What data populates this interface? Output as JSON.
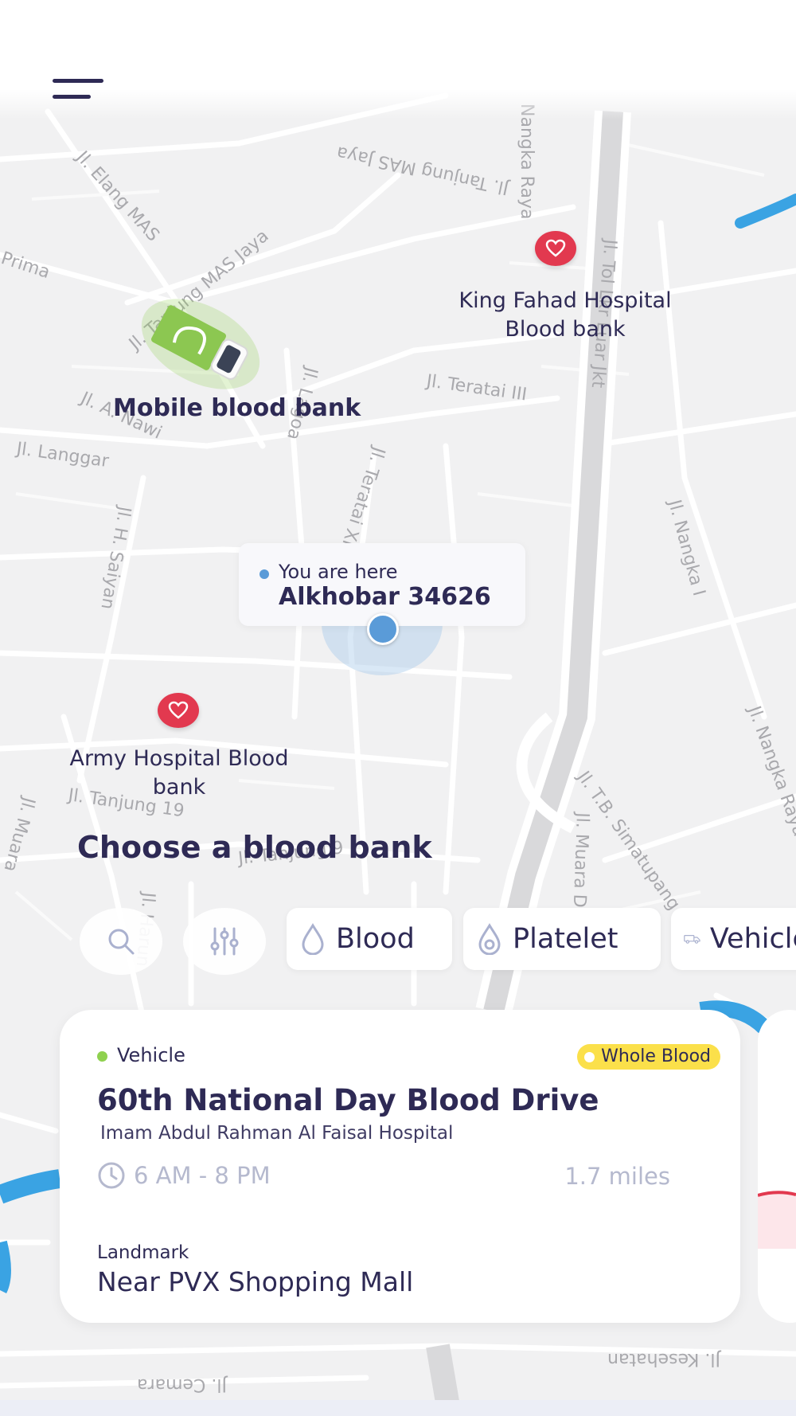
{
  "map": {
    "mobile_unit_label": "Mobile blood bank",
    "hospitals": [
      {
        "name": "King Fahad Hospital Blood bank"
      },
      {
        "name": "Army Hospital Blood bank"
      }
    ],
    "streets": [
      "Jl. Tanjung MAS Jaya",
      "Jl. Elang MAS",
      "Jl. Tanjung MAS Jaya",
      "Prima",
      "Jl. Teratai III",
      "Jl. Langgar",
      "Jl. H. Saiyan",
      "Jl. Teratai XI",
      "Jl. Nangka I",
      "Jl. T.B. Simatupang",
      "Jl. Tanjung 19",
      "Jl. Tanjung 9",
      "Jl. Kesehatan",
      "Jl. Cemara",
      "Jl. Muara Da",
      "Jl. Harun",
      "Jl. Tol Lkr Luar Jkt",
      "Jl. Nangka Raya",
      "Jl. A. Nawi",
      "Jl. Lagoa",
      "Nangka Raya",
      "Jl. Muara"
    ],
    "you_are_here": {
      "caption": "You are here",
      "location": "Alkhobar 34626"
    }
  },
  "section_title": "Choose a blood bank",
  "filters": {
    "chips": [
      {
        "label": "Blood",
        "icon": "drop-icon"
      },
      {
        "label": "Platelet",
        "icon": "platelet-icon"
      },
      {
        "label": "Vehicle",
        "icon": "truck-icon"
      }
    ]
  },
  "card": {
    "type": "Vehicle",
    "badge": "Whole Blood",
    "title": "60th National Day Blood Drive",
    "subtitle": "Imam Abdul Rahman Al Faisal Hospital",
    "time": "6 AM - 8 PM",
    "distance": "1.7 miles",
    "landmark_label": "Landmark",
    "landmark": "Near PVX Shopping Mall"
  },
  "colors": {
    "primary": "#2e2a55",
    "pin": "#e2394f",
    "location": "#5a9bd8",
    "badge": "#fbe04a",
    "vehicle_dot": "#8fd14f"
  }
}
